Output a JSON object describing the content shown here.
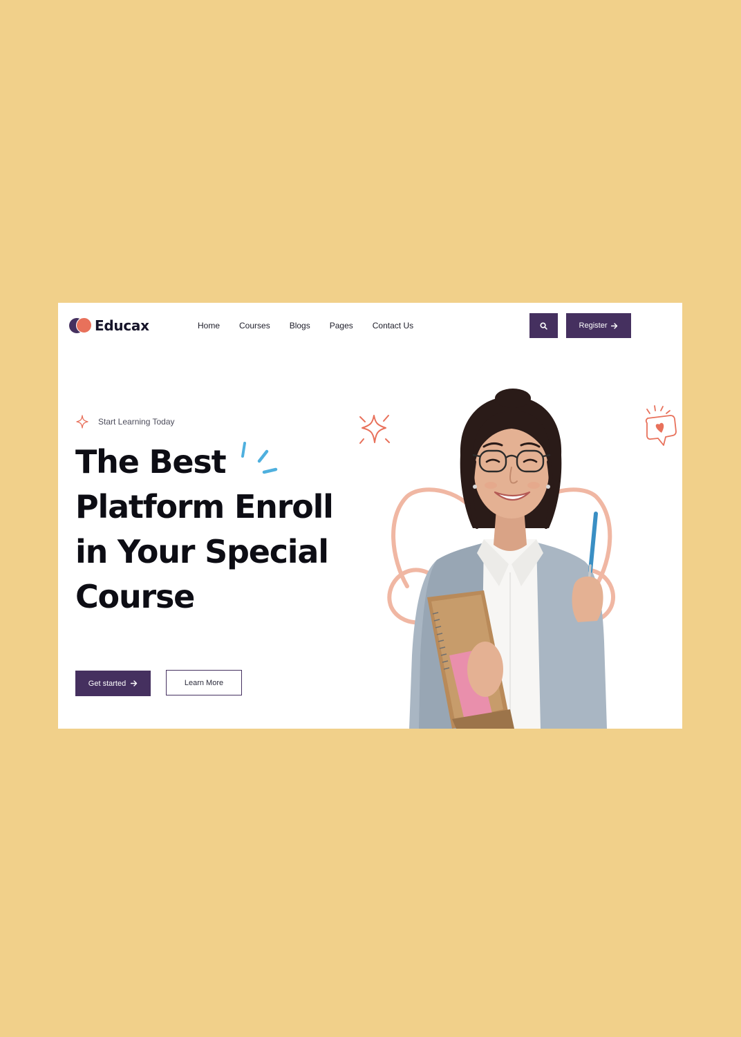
{
  "header": {
    "logo_text": "Educax",
    "nav": [
      "Home",
      "Courses",
      "Blogs",
      "Pages",
      "Contact Us"
    ],
    "register_label": "Register"
  },
  "hero": {
    "eyebrow": "Start Learning Today",
    "title_lines": [
      "The Best",
      "Platform Enroll",
      "in Your Special",
      "Course"
    ],
    "primary_cta": "Get started",
    "secondary_cta": "Learn More"
  },
  "icons": {
    "search": "search-icon",
    "arrow": "arrow-right-icon",
    "eyebrow": "sparkle-icon",
    "decor_star": "sparkle-star-icon",
    "decor_heart": "heart-chat-icon"
  },
  "colors": {
    "page_bg": "#f1d08a",
    "primary": "#45305f",
    "accent": "#e8715b",
    "splash": "#4fb0de",
    "ribbon": "#f0b7a3"
  }
}
